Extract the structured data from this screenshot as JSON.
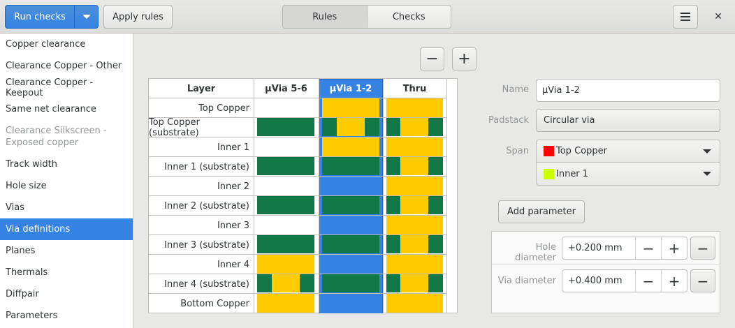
{
  "header": {
    "run_checks": "Run checks",
    "apply_rules": "Apply rules",
    "tabs": [
      "Rules",
      "Checks"
    ],
    "accent": "#3584e4"
  },
  "sidebar": {
    "items": [
      "Copper clearance",
      "Clearance Copper - Other",
      "Clearance Copper - Keepout",
      "Same net clearance",
      "Clearance Silkscreen -\nExposed copper",
      "Track width",
      "Hole size",
      "Vias",
      "Via definitions",
      "Planes",
      "Thermals",
      "Diffpair",
      "Parameters"
    ],
    "selected": "Via definitions"
  },
  "layers_table": {
    "headers": [
      "Layer",
      "µVia 5-6",
      "µVia 1-2",
      "Thru"
    ],
    "rows": [
      "Top Copper",
      "Top Copper (substrate)",
      "Inner 1",
      "Inner 1 (substrate)",
      "Inner 2",
      "Inner 2 (substrate)",
      "Inner 3",
      "Inner 3 (substrate)",
      "Inner 4",
      "Inner 4 (substrate)",
      "Bottom Copper"
    ],
    "colors": {
      "copper": "#ffcc00",
      "substrate": "#127847",
      "selection": "#3584e4"
    }
  },
  "details": {
    "name_label": "Name",
    "name_value": "µVia 1-2",
    "padstack_label": "Padstack",
    "padstack_value": "Circular via",
    "span_label": "Span",
    "span_from": {
      "label": "Top Copper",
      "color": "#ff0000"
    },
    "span_to": {
      "label": "Inner 1",
      "color": "#ccff00"
    },
    "add_parameter": "Add parameter",
    "params": [
      {
        "label": "Hole diameter",
        "value": "+0.200 mm"
      },
      {
        "label": "Via diameter",
        "value": "+0.400 mm"
      }
    ]
  }
}
